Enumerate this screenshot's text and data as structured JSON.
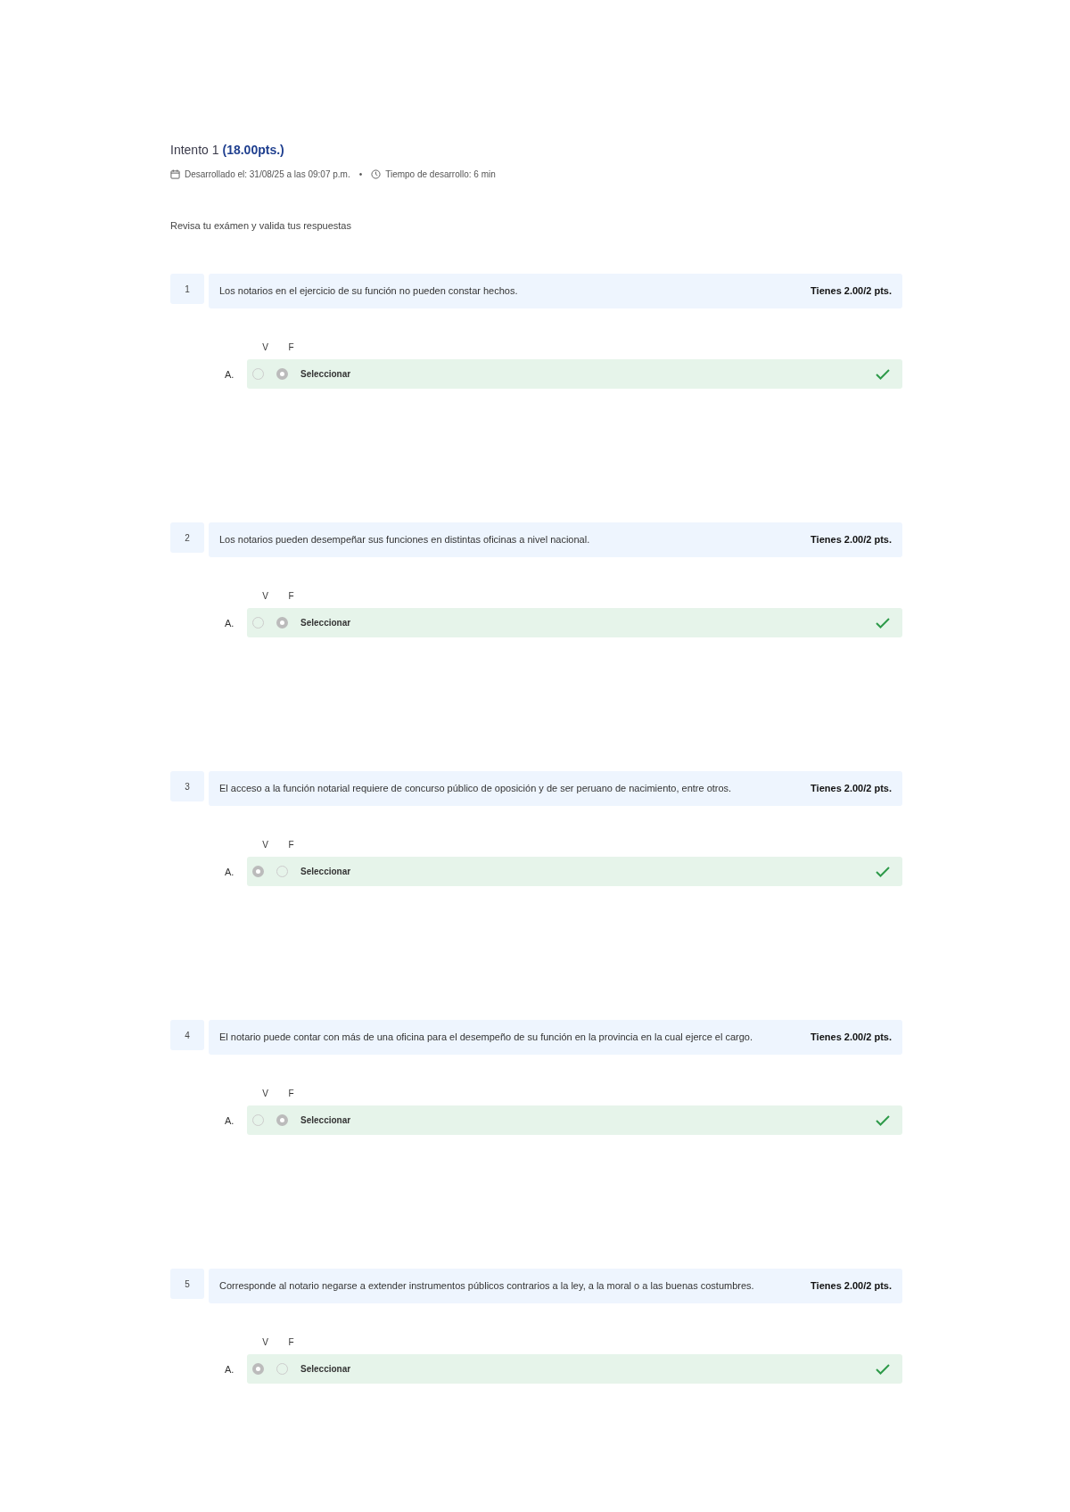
{
  "attempt": {
    "title": "Intento 1",
    "score": "(18.00pts.)",
    "developed": "Desarrollado el: 31/08/25 a las 09:07 p.m.",
    "separator": "•",
    "duration": "Tiempo de desarrollo: 6 min"
  },
  "instruction": "Revisa tu exámen y valida tus respuestas",
  "questions": [
    {
      "number": "1",
      "text": "Los notarios en el ejercicio de su función no pueden constar hechos.",
      "points": "Tienes 2.00/2 pts.",
      "columns": [
        "V",
        "F"
      ],
      "options": [
        {
          "letter": "A.",
          "label": "Seleccionar",
          "correct": true,
          "choices": [
            {
              "selected": false
            },
            {
              "selected": true
            }
          ]
        }
      ]
    },
    {
      "number": "2",
      "text": "Los notarios pueden desempeñar sus funciones en distintas oficinas a nivel nacional.",
      "points": "Tienes 2.00/2 pts.",
      "columns": [
        "V",
        "F"
      ],
      "options": [
        {
          "letter": "A.",
          "label": "Seleccionar",
          "correct": true,
          "choices": [
            {
              "selected": false
            },
            {
              "selected": true
            }
          ]
        }
      ]
    },
    {
      "number": "3",
      "text": "El acceso a la función notarial requiere de concurso público de oposición y de ser peruano de nacimiento, entre otros.",
      "points": "Tienes 2.00/2 pts.",
      "columns": [
        "V",
        "F"
      ],
      "options": [
        {
          "letter": "A.",
          "label": "Seleccionar",
          "correct": true,
          "choices": [
            {
              "selected": true
            },
            {
              "selected": false
            }
          ]
        }
      ]
    },
    {
      "number": "4",
      "text": "El notario puede contar con más de una oficina para el desempeño de su función en la provincia en la cual ejerce el cargo.",
      "points": "Tienes 2.00/2 pts.",
      "columns": [
        "V",
        "F"
      ],
      "options": [
        {
          "letter": "A.",
          "label": "Seleccionar",
          "correct": true,
          "choices": [
            {
              "selected": false
            },
            {
              "selected": true
            }
          ]
        }
      ]
    },
    {
      "number": "5",
      "text": "Corresponde al notario negarse a extender instrumentos públicos contrarios a la ley, a la moral o a las buenas costumbres.",
      "points": "Tienes 2.00/2 pts.",
      "columns": [
        "V",
        "F"
      ],
      "options": [
        {
          "letter": "A.",
          "label": "Seleccionar",
          "correct": true,
          "choices": [
            {
              "selected": true
            },
            {
              "selected": false
            }
          ]
        }
      ]
    }
  ]
}
